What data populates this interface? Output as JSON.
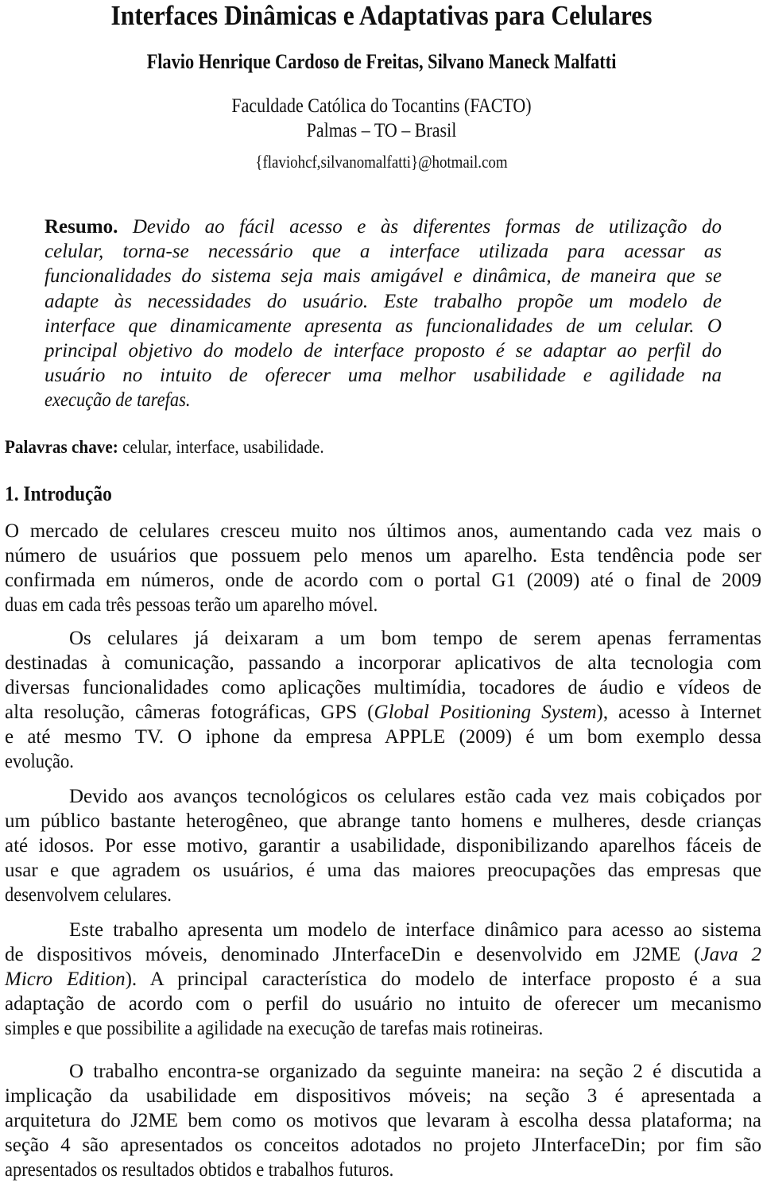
{
  "document": {
    "title": "Interfaces Dinâmicas e Adaptativas para Celulares",
    "authors": "Flavio Henrique Cardoso de Freitas, Silvano Maneck Malfatti",
    "affiliation": {
      "institution": "Faculdade Católica do Tocantins (FACTO)",
      "location": "Palmas – TO – Brasil",
      "email": "{flaviohcf,silvanomalfatti}@hotmail.com"
    },
    "abstract": {
      "label": "Resumo.",
      "lines": [
        " Devido ao fácil acesso e às diferentes formas de utilização do",
        "celular, torna-se necessário que a interface utilizada para acessar as",
        "funcionalidades do sistema seja mais amigável e dinâmica, de maneira que se",
        "adapte às necessidades do usuário. Este trabalho propõe um modelo de",
        "interface que dinamicamente apresenta as funcionalidades de um celular. O",
        "principal objetivo do modelo de interface proposto é se adaptar ao perfil do",
        "usuário no intuito de oferecer uma melhor usabilidade e agilidade na",
        "execução de tarefas."
      ]
    },
    "keywords": {
      "label": "Palavras chave:",
      "value": " celular, interface, usabilidade."
    },
    "section": {
      "heading": "1. Introdução",
      "paragraphs": [
        {
          "lines": [
            "O mercado de celulares cresceu muito nos últimos anos, aumentando cada vez mais o",
            "número de usuários que possuem pelo menos um aparelho. Esta tendência pode ser",
            "confirmada em números, onde de acordo com o portal G1 (2009) até o final de 2009",
            "duas em cada três pessoas terão um aparelho móvel."
          ]
        },
        {
          "lines": [
            "Os celulares já deixaram a um bom tempo de serem apenas ferramentas",
            "destinadas à comunicação, passando a incorporar aplicativos de alta tecnologia com",
            "diversas funcionalidades como aplicações multimídia, tocadores de áudio e vídeos de",
            "alta resolução, câmeras fotográficas, GPS (",
            "e até mesmo TV. O iphone da empresa APPLE (2009) é um bom exemplo dessa",
            "evolução."
          ],
          "line4_italic": "Global Positioning System",
          "line4_tail": "), acesso à Internet"
        },
        {
          "lines": [
            "Devido aos avanços tecnológicos os celulares estão cada vez mais cobiçados por",
            "um público bastante heterogêneo, que abrange tanto homens e mulheres, desde crianças",
            "até idosos. Por esse motivo, garantir a usabilidade, disponibilizando aparelhos fáceis de",
            "usar e que agradem os usuários, é uma das maiores preocupações das empresas que",
            "desenvolvem celulares."
          ]
        },
        {
          "lines": [
            "Este trabalho apresenta um modelo de interface dinâmico para acesso ao sistema",
            "de dispositivos móveis, denominado JInterfaceDin e desenvolvido em J2ME (",
            "). A principal característica do modelo de interface proposto é a sua",
            "adaptação de acordo com o perfil do usuário no intuito de oferecer um mecanismo",
            "simples e que possibilite a agilidade na execução de tarefas mais rotineiras."
          ],
          "line2_italic": "Java 2",
          "line3_italic": "Micro Edition"
        },
        {
          "lines": [
            "O trabalho encontra-se organizado da seguinte maneira: na seção 2 é discutida a",
            "implicação da usabilidade em dispositivos móveis; na seção 3 é apresentada a",
            "arquitetura do J2ME bem como os motivos que levaram à escolha dessa plataforma; na",
            "seção 4 são apresentados os conceitos adotados no projeto JInterfaceDin; por fim são",
            "apresentados os resultados obtidos e trabalhos futuros."
          ]
        }
      ]
    }
  }
}
